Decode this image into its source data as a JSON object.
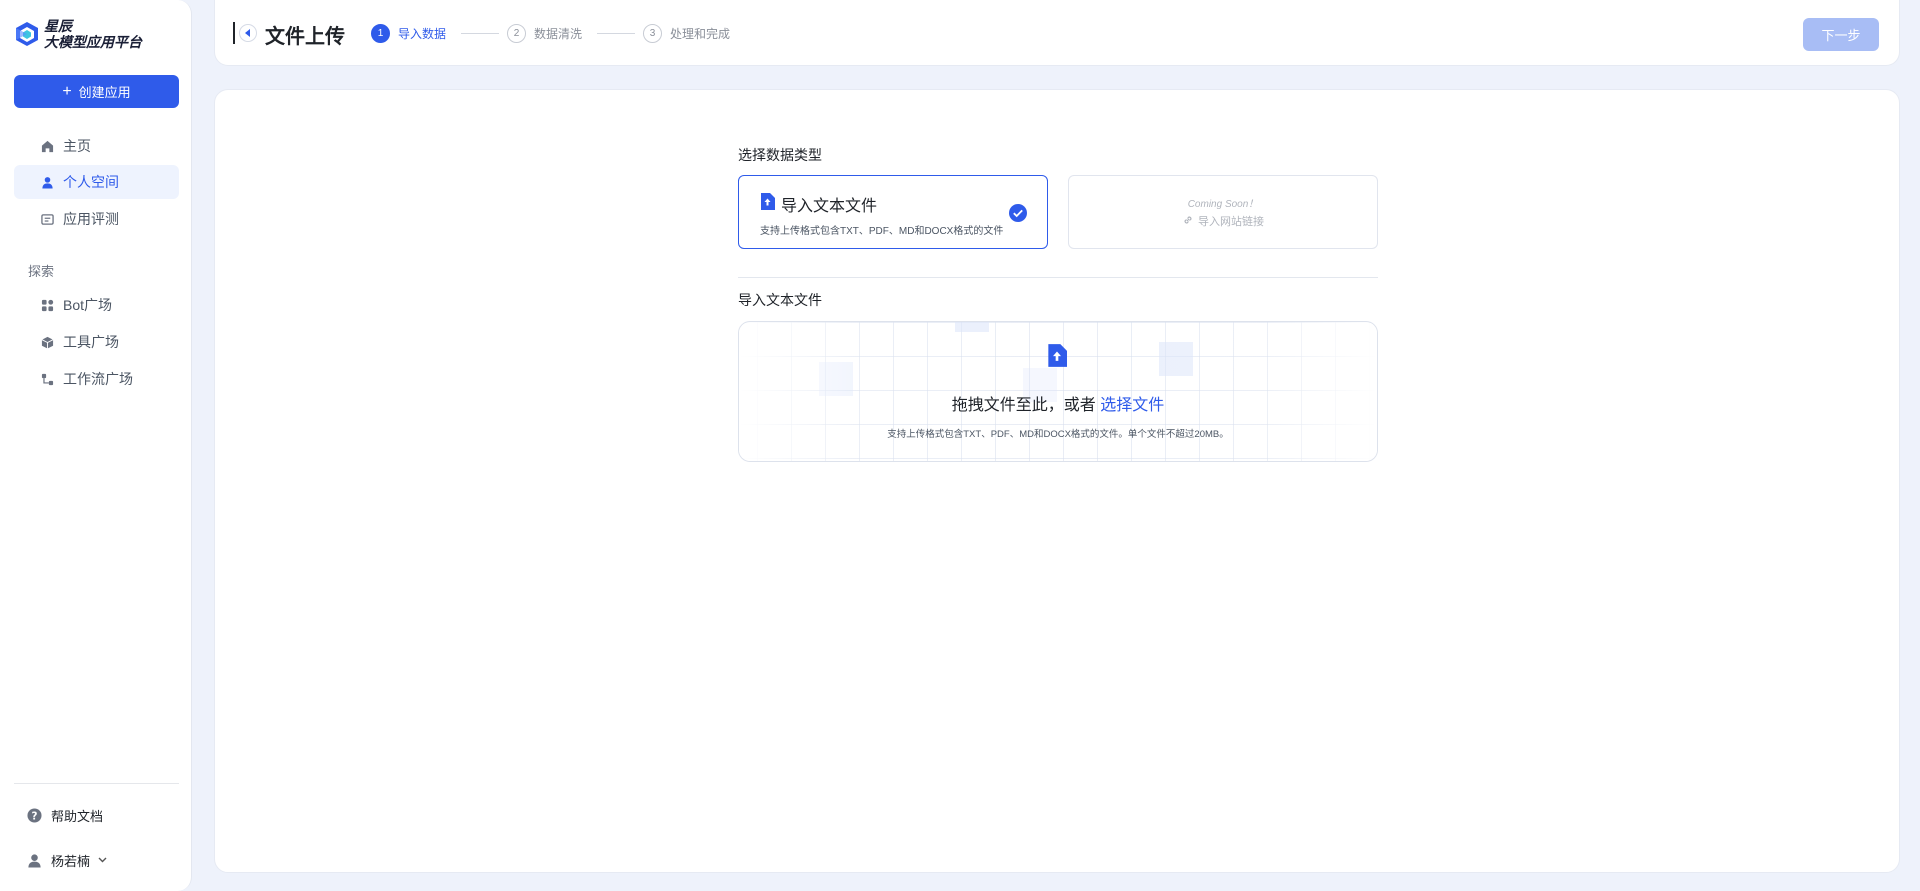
{
  "app": {
    "logo_line1": "星辰",
    "logo_line2": "大模型应用平台",
    "brand_color": "#2f5bea"
  },
  "sidebar": {
    "create_label": "创建应用",
    "items": [
      {
        "label": "主页",
        "icon": "home-icon",
        "active": false
      },
      {
        "label": "个人空间",
        "icon": "user-icon",
        "active": true
      },
      {
        "label": "应用评测",
        "icon": "evaluation-icon",
        "active": false
      }
    ],
    "explore_label": "探索",
    "explore_items": [
      {
        "label": "Bot广场",
        "icon": "grid-icon"
      },
      {
        "label": "工具广场",
        "icon": "cube-icon"
      },
      {
        "label": "工作流广场",
        "icon": "workflow-icon"
      }
    ],
    "help_label": "帮助文档",
    "user_name": "杨若楠"
  },
  "header": {
    "title": "文件上传",
    "steps": [
      {
        "num": "1",
        "label": "导入数据",
        "active": true
      },
      {
        "num": "2",
        "label": "数据清洗",
        "active": false
      },
      {
        "num": "3",
        "label": "处理和完成",
        "active": false
      }
    ],
    "next_label": "下一步"
  },
  "main": {
    "select_type_label": "选择数据类型",
    "text_file_card": {
      "title": "导入文本文件",
      "desc": "支持上传格式包含TXT、PDF、MD和DOCX格式的文件"
    },
    "url_card": {
      "coming_soon": "Coming Soon！",
      "title": "导入网站链接"
    },
    "import_label": "导入文本文件",
    "dropzone": {
      "prompt": "拖拽文件至此，或者",
      "link": "选择文件",
      "hint": "支持上传格式包含TXT、PDF、MD和DOCX格式的文件。单个文件不超过20MB。"
    }
  }
}
